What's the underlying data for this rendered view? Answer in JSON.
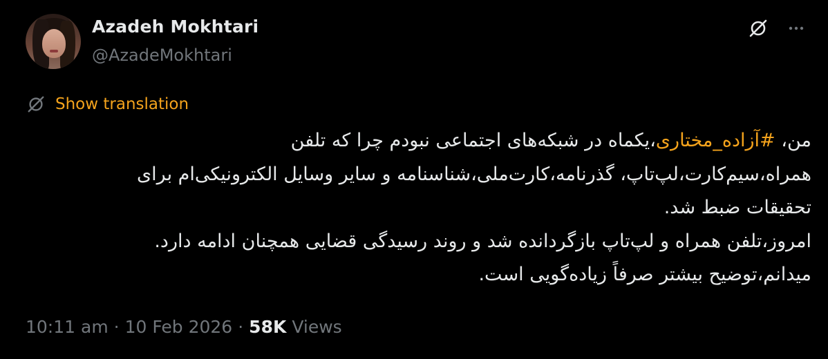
{
  "author": {
    "display_name": "Azadeh Mokhtari",
    "handle": "@AzadeMokhtari"
  },
  "icons": {
    "grok": "grok-slash-icon",
    "more": "more-horizontal-icon",
    "translate": "translate-icon"
  },
  "colors": {
    "accent": "#f4a31c",
    "secondary_text": "#71767b",
    "primary_text": "#e7e9ea",
    "background": "#000000"
  },
  "translation": {
    "label": "Show translation"
  },
  "tweet": {
    "line1_prefix": "من، ",
    "hashtag": "#آزاده_مختاری",
    "line1_suffix": "،یکماه در شبکه‌های اجتماعی نبودم چرا که تلفن",
    "line2": "همراه،سیم‌کارت،لپ‌تاپ، گذرنامه،کارت‌ملی،شناسنامه و سایر وسایل الکترونیکی‌ام برای",
    "line3": "تحقیقات ضبط شد.",
    "line4": "امروز،تلفن همراه و لپ‌تاپ بازگردانده شد و روند رسیدگی قضایی همچنان ادامه دارد.",
    "line5": "میدانم،توضیح بیشتر صرفاً زیاده‌گویی است."
  },
  "meta": {
    "time": "10:11 am",
    "separator": "·",
    "date": "10 Feb 2026",
    "views_count": "58K",
    "views_label": "Views"
  }
}
